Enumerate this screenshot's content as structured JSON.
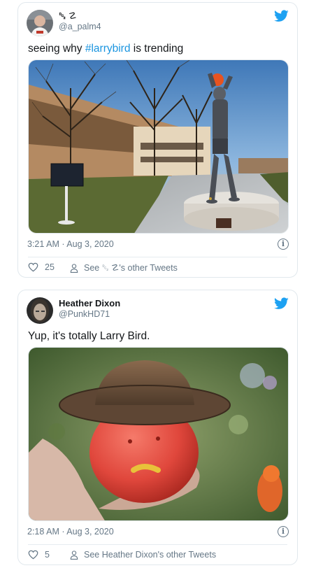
{
  "tweets": [
    {
      "display_name": "␒ ☡",
      "handle": "@a_palm4",
      "text_prefix": "seeing why ",
      "hashtag": "#larrybird",
      "text_suffix": " is trending",
      "timestamp": "3:21 AM · Aug 3, 2020",
      "like_count": "25",
      "profile_link": "See ␒ ☡'s other Tweets"
    },
    {
      "display_name": "Heather Dixon",
      "handle": "@PunkHD71",
      "text": "Yup, it's totally Larry Bird.",
      "timestamp": "2:18 AM · Aug 3, 2020",
      "like_count": "5",
      "profile_link": "See Heather Dixon's other Tweets"
    }
  ],
  "icons": {
    "brand": "twitter-bird-icon",
    "like": "heart-outline-icon",
    "profile": "person-icon",
    "info": "info-circle-icon"
  },
  "colors": {
    "twitter_blue": "#1da1f2",
    "hashtag": "#1b95e0",
    "secondary_text": "#657786",
    "border": "#e1e8ed"
  }
}
